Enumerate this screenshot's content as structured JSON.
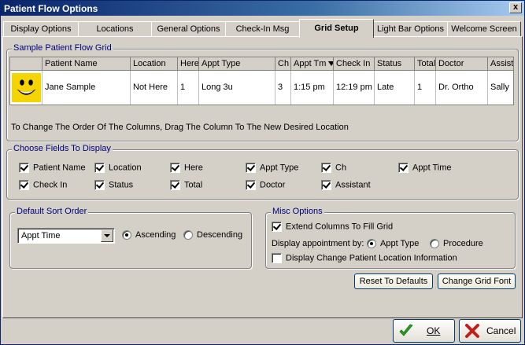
{
  "window": {
    "title": "Patient Flow Options",
    "close_glyph": "x"
  },
  "tabs": [
    {
      "label": "Display Options"
    },
    {
      "label": "Locations"
    },
    {
      "label": "General Options"
    },
    {
      "label": "Check-In Msg"
    },
    {
      "label": "Grid Setup",
      "active": true
    },
    {
      "label": "Light Bar Options"
    },
    {
      "label": "Welcome Screen"
    }
  ],
  "sample_grid": {
    "legend": "Sample Patient Flow Grid",
    "headers": [
      "Patient Name",
      "Location",
      "Here",
      "Appt Type",
      "Ch",
      "Appt Tm",
      "Check In",
      "Status",
      "Total",
      "Doctor",
      "Assist"
    ],
    "row": [
      "Jane Sample",
      "Not Here",
      "1",
      "Long 3u",
      "3",
      "1:15 pm",
      "12:19 pm",
      "Late",
      "1",
      "Dr. Ortho",
      "Sally"
    ],
    "avatar_icon": "smiley-face-icon",
    "hint": "To Change The Order Of The Columns, Drag The Column To The New Desired Location"
  },
  "fields": {
    "legend": "Choose Fields To Display",
    "items": [
      {
        "label": "Patient Name",
        "checked": true
      },
      {
        "label": "Location",
        "checked": true
      },
      {
        "label": "Here",
        "checked": true
      },
      {
        "label": "Appt Type",
        "checked": true
      },
      {
        "label": "Ch",
        "checked": true
      },
      {
        "label": "Appt Time",
        "checked": true
      },
      {
        "label": "Check In",
        "checked": true
      },
      {
        "label": "Status",
        "checked": true
      },
      {
        "label": "Total",
        "checked": true
      },
      {
        "label": "Doctor",
        "checked": true
      },
      {
        "label": "Assistant",
        "checked": true
      }
    ]
  },
  "sort": {
    "legend": "Default Sort Order",
    "selected": "Appt Time",
    "ascending_label": "Ascending",
    "descending_label": "Descending",
    "direction": "ascending"
  },
  "misc": {
    "legend": "Misc Options",
    "extend_label": "Extend Columns To Fill Grid",
    "extend_checked": true,
    "display_by_label": "Display appointment by:",
    "appt_type_label": "Appt Type",
    "procedure_label": "Procedure",
    "display_by": "appt_type",
    "change_loc_label": "Display Change Patient Location Information",
    "change_loc_checked": false
  },
  "buttons": {
    "reset": "Reset To Defaults",
    "font": "Change Grid Font",
    "ok": "OK",
    "cancel": "Cancel"
  },
  "colors": {
    "group_label": "#00007a",
    "titlebar": "#0a246a",
    "ok_check": "#2a9d2a",
    "cancel_x": "#c0201a"
  }
}
